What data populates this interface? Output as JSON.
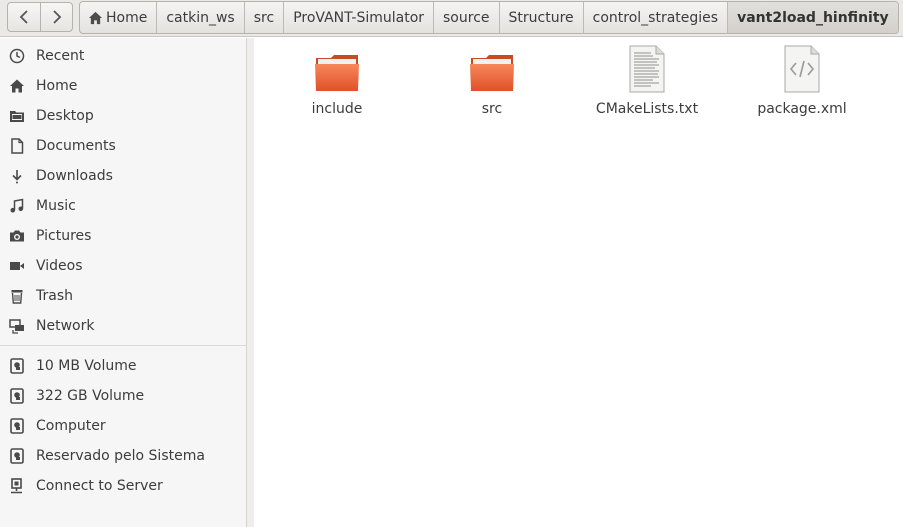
{
  "toolbar": {
    "back_icon": "chevron-left-icon",
    "forward_icon": "chevron-right-icon"
  },
  "breadcrumbs": [
    {
      "label": "Home",
      "icon": "home-icon"
    },
    {
      "label": "catkin_ws"
    },
    {
      "label": "src"
    },
    {
      "label": "ProVANT-Simulator"
    },
    {
      "label": "source"
    },
    {
      "label": "Structure"
    },
    {
      "label": "control_strategies"
    },
    {
      "label": "vant2load_hinfinity",
      "active": true
    }
  ],
  "sidebar": {
    "places": [
      {
        "label": "Recent",
        "icon": "clock-icon"
      },
      {
        "label": "Home",
        "icon": "home-icon"
      },
      {
        "label": "Desktop",
        "icon": "folder-icon"
      },
      {
        "label": "Documents",
        "icon": "document-icon"
      },
      {
        "label": "Downloads",
        "icon": "download-icon"
      },
      {
        "label": "Music",
        "icon": "music-icon"
      },
      {
        "label": "Pictures",
        "icon": "camera-icon"
      },
      {
        "label": "Videos",
        "icon": "video-icon"
      },
      {
        "label": "Trash",
        "icon": "trash-icon"
      },
      {
        "label": "Network",
        "icon": "network-icon"
      }
    ],
    "devices": [
      {
        "label": "10 MB Volume",
        "icon": "drive-icon"
      },
      {
        "label": "322 GB Volume",
        "icon": "drive-icon"
      },
      {
        "label": "Computer",
        "icon": "drive-icon"
      },
      {
        "label": "Reservado pelo Sistema",
        "icon": "drive-icon"
      },
      {
        "label": "Connect to Server",
        "icon": "server-icon"
      }
    ]
  },
  "files": [
    {
      "name": "include",
      "type": "folder",
      "icon": "folder-icon"
    },
    {
      "name": "src",
      "type": "folder",
      "icon": "folder-icon"
    },
    {
      "name": "CMakeLists.txt",
      "type": "text",
      "icon": "text-file-icon"
    },
    {
      "name": "package.xml",
      "type": "xml",
      "icon": "xml-file-icon"
    }
  ],
  "colors": {
    "folder_orange": "#f0643a",
    "toolbar_bg": "#eae9e6",
    "sidebar_bg": "#f6f6f6"
  }
}
